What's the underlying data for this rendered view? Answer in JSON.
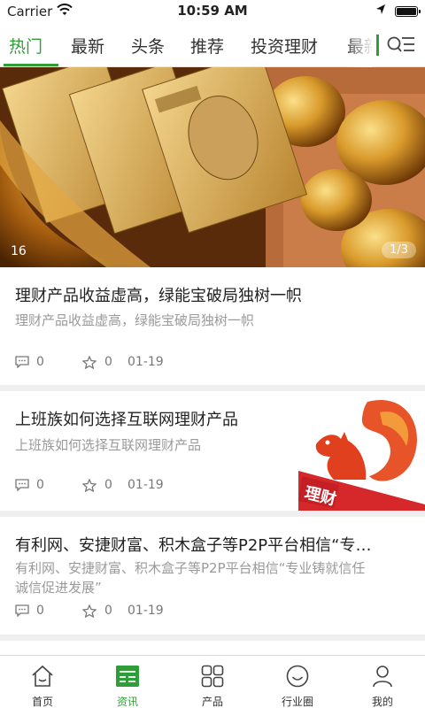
{
  "status_bar": {
    "carrier": "Carrier",
    "time": "10:59 AM",
    "icons": [
      "wifi-icon",
      "location-arrow-icon",
      "battery-icon"
    ]
  },
  "tabs": {
    "items": [
      "热门",
      "最新",
      "头条",
      "推荐",
      "投资理财",
      "最新"
    ],
    "active_index": 0,
    "menu_icon": "search-list-icon",
    "accent_color": "#2f9e38"
  },
  "banner": {
    "counter": "16",
    "page_indicator": "1/3"
  },
  "articles": [
    {
      "title": "理财产品收益虚高，绿能宝破局独树一帜",
      "summary": "理财产品收益虚高，绿能宝破局独树一帜",
      "comments": "0",
      "favorites": "0",
      "date": "01-19"
    },
    {
      "title": "上班族如何选择互联网理财产品",
      "summary": "上班族如何选择互联网理财产品",
      "comments": "0",
      "favorites": "0",
      "date": "01-19",
      "thumb_label": "理财"
    },
    {
      "title": "有利网、安捷财富、积木盒子等P2P平台相信“专…",
      "summary_line1": "有利网、安捷财富、积木盒子等P2P平台相信“专业铸就信任",
      "summary_line2": "诚信促进发展”",
      "comments": "0",
      "favorites": "0",
      "date": "01-19"
    }
  ],
  "bottom_nav": {
    "items": [
      {
        "label": "首页",
        "icon": "home-icon"
      },
      {
        "label": "资讯",
        "icon": "news-icon"
      },
      {
        "label": "产品",
        "icon": "grid-icon"
      },
      {
        "label": "行业圈",
        "icon": "smile-icon"
      },
      {
        "label": "我的",
        "icon": "person-icon"
      }
    ],
    "active_index": 1
  }
}
